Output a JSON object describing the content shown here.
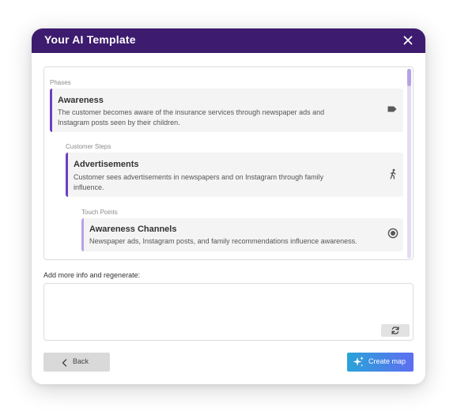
{
  "modal": {
    "title": "Your AI Template",
    "close_icon": "close-icon"
  },
  "template": {
    "phases_label": "Phases",
    "phase": {
      "title": "Awareness",
      "description_line1": "The customer becomes aware of the insurance services through newspaper ads and",
      "description_line2": "Instagram posts seen by their children.",
      "icon": "tag-icon"
    },
    "customer_steps_label": "Customer Steps",
    "step": {
      "title": "Advertisements",
      "description_line1": "Customer sees advertisements in newspapers and on Instagram through family",
      "description_line2": "influence.",
      "icon": "walking-person-icon"
    },
    "touch_points_label": "Touch Points",
    "touch_point": {
      "title": "Awareness Channels",
      "description": "Newspaper ads, Instagram posts, and family recommendations influence awareness.",
      "icon": "radio-target-icon"
    }
  },
  "regenerate": {
    "label": "Add more info and regenerate:",
    "value": "",
    "icon": "refresh-icon"
  },
  "footer": {
    "back_label": "Back",
    "create_label": "Create map",
    "create_icon": "sparkle-icon"
  },
  "colors": {
    "header_bg": "#3d1b6e",
    "accent": "#6b3fbf",
    "touchpoint_accent": "#b6a3e6",
    "create_gradient_start": "#29a3d9",
    "create_gradient_end": "#5e6ef0"
  }
}
